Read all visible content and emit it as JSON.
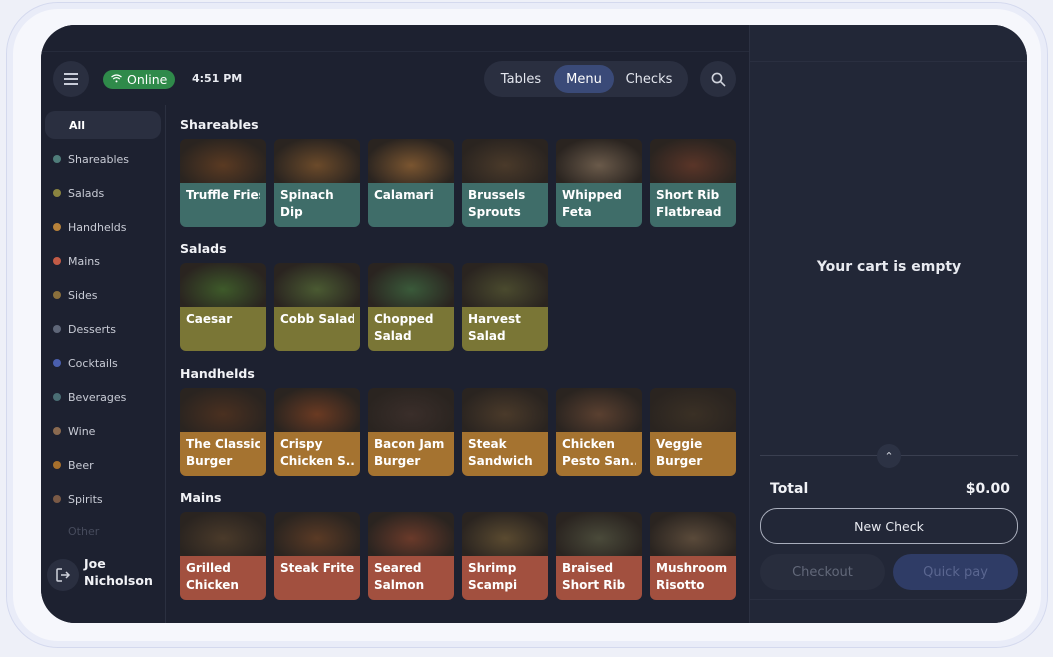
{
  "header": {
    "status": "Online",
    "time": "4:51 PM",
    "tabs": [
      "Tables",
      "Menu",
      "Checks"
    ],
    "active_tab": "Menu"
  },
  "sidebar": {
    "items": [
      {
        "label": "All",
        "color": ""
      },
      {
        "label": "Shareables",
        "color": "#4f7d7a"
      },
      {
        "label": "Salads",
        "color": "#8a8440"
      },
      {
        "label": "Handhelds",
        "color": "#b8823a"
      },
      {
        "label": "Mains",
        "color": "#c25b46"
      },
      {
        "label": "Sides",
        "color": "#8a6f3c"
      },
      {
        "label": "Desserts",
        "color": "#5e6678"
      },
      {
        "label": "Cocktails",
        "color": "#4a5fae"
      },
      {
        "label": "Beverages",
        "color": "#4a6e74"
      },
      {
        "label": "Wine",
        "color": "#8a6a50"
      },
      {
        "label": "Beer",
        "color": "#a66f2c"
      },
      {
        "label": "Spirits",
        "color": "#7a5a46"
      },
      {
        "label": "Other",
        "color": ""
      }
    ],
    "user": [
      "Joe",
      "Nicholson"
    ]
  },
  "menu": {
    "sections": [
      {
        "title": "Shareables",
        "color": "teal",
        "items": [
          [
            "Truffle Fries"
          ],
          [
            "Spinach",
            "Dip"
          ],
          [
            "Calamari"
          ],
          [
            "Brussels",
            "Sprouts"
          ],
          [
            "Whipped",
            "Feta"
          ],
          [
            "Short Rib",
            "Flatbread"
          ]
        ]
      },
      {
        "title": "Salads",
        "color": "olive",
        "items": [
          [
            "Caesar"
          ],
          [
            "Cobb Salad"
          ],
          [
            "Chopped",
            "Salad"
          ],
          [
            "Harvest",
            "Salad"
          ]
        ]
      },
      {
        "title": "Handhelds",
        "color": "amber",
        "items": [
          [
            "The Classic",
            "Burger"
          ],
          [
            "Crispy",
            "Chicken S..."
          ],
          [
            "Bacon Jam",
            "Burger"
          ],
          [
            "Steak",
            "Sandwich"
          ],
          [
            "Chicken",
            "Pesto San..."
          ],
          [
            "Veggie",
            "Burger"
          ]
        ]
      },
      {
        "title": "Mains",
        "color": "red",
        "items": [
          [
            "Grilled",
            "Chicken"
          ],
          [
            "Steak Frites"
          ],
          [
            "Seared",
            "Salmon"
          ],
          [
            "Shrimp",
            "Scampi"
          ],
          [
            "Braised",
            "Short Rib"
          ],
          [
            "Mushroom",
            "Risotto"
          ]
        ]
      }
    ]
  },
  "cart": {
    "empty_text": "Your cart is empty",
    "total_label": "Total",
    "total_value": "$0.00",
    "new_check": "New Check",
    "checkout": "Checkout",
    "quick_pay": "Quick pay"
  }
}
